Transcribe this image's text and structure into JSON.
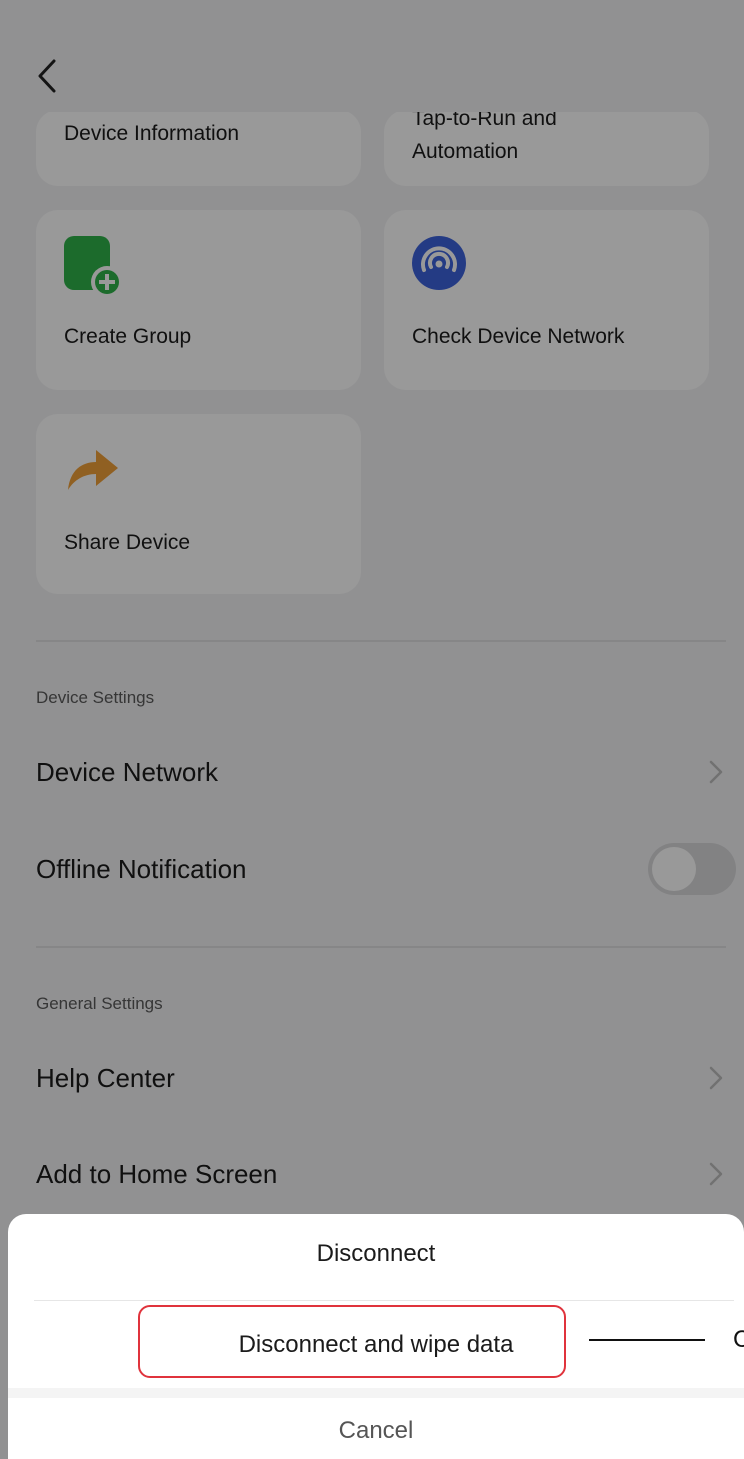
{
  "tiles": {
    "device_information": "Device Information",
    "tap_to_run_line1": "Tap-to-Run and",
    "tap_to_run_line2": "Automation",
    "create_group": "Create Group",
    "check_device_network": "Check Device Network",
    "share_device": "Share Device"
  },
  "device_settings": {
    "title": "Device Settings",
    "device_network": "Device Network",
    "offline_notification": "Offline Notification",
    "offline_notification_enabled": false
  },
  "general_settings": {
    "title": "General Settings",
    "help_center": "Help Center",
    "add_to_home_screen": "Add to Home Screen"
  },
  "sheet": {
    "disconnect": "Disconnect",
    "disconnect_wipe": "Disconnect and wipe data",
    "cancel": "Cancel"
  },
  "annotation": {
    "callout_text": "C"
  },
  "icons": {
    "back": "chevron-left-icon",
    "create_group": "group-add-icon",
    "check_network": "network-signal-icon",
    "share": "share-arrow-icon",
    "row_arrow": "chevron-right-icon"
  },
  "colors": {
    "group_green": "#2fb24a",
    "network_blue": "#3d63dd",
    "share_orange": "#f0a03a",
    "highlight_red": "#e0333c"
  }
}
